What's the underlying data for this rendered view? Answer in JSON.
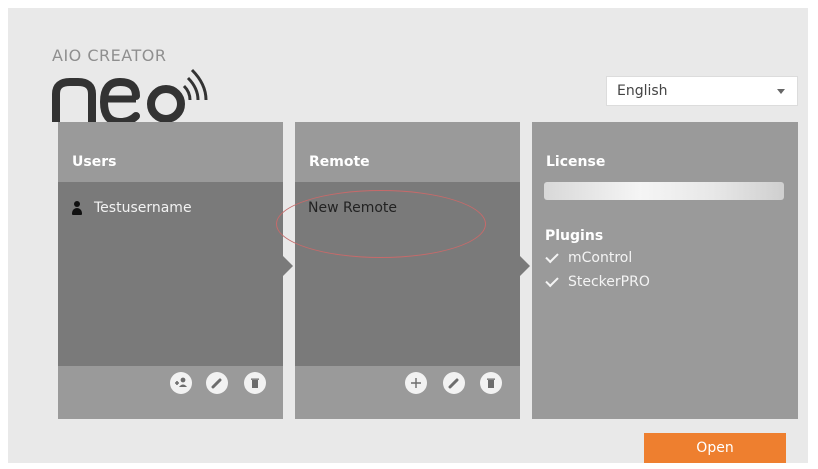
{
  "brand": {
    "top": "AIO CREATOR",
    "main": "neo"
  },
  "language": {
    "selected": "English"
  },
  "users": {
    "title": "Users",
    "items": [
      {
        "name": "Testusername"
      }
    ]
  },
  "remote": {
    "title": "Remote",
    "items": [
      {
        "name": "New Remote"
      }
    ]
  },
  "license": {
    "title": "License",
    "plugins_title": "Plugins",
    "plugins": [
      "mControl",
      "SteckerPRO"
    ]
  },
  "actions": {
    "open_label": "Open"
  },
  "colors": {
    "accent": "#ee7f2f",
    "panel": "#9a9a9a",
    "panel_dark": "#7a7a7a",
    "annotation": "#c76a6a"
  },
  "icons": [
    "add-user-icon",
    "edit-icon",
    "delete-icon",
    "add-icon",
    "check-icon",
    "dropdown-caret-icon",
    "wifi-icon"
  ]
}
